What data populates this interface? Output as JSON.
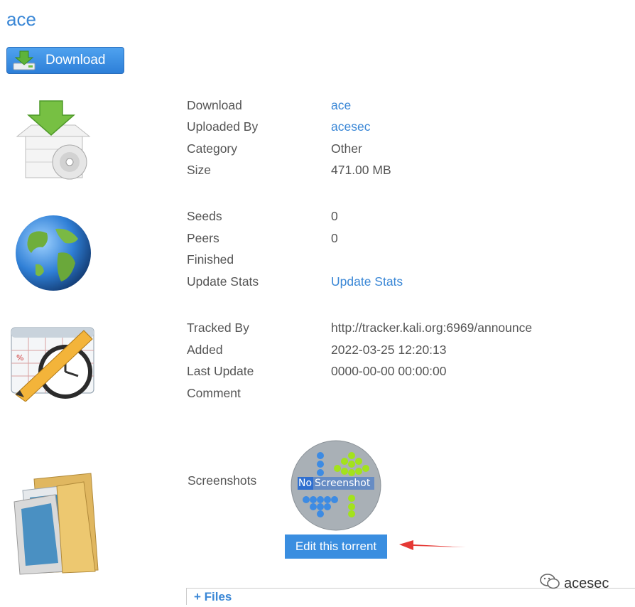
{
  "page": {
    "title": "ace"
  },
  "download_button": {
    "label": "Download",
    "icon": "download-icon"
  },
  "info": {
    "download_label": "Download",
    "download_value": "ace",
    "uploaded_by_label": "Uploaded By",
    "uploaded_by_value": "acesec",
    "category_label": "Category",
    "category_value": "Other",
    "size_label": "Size",
    "size_value": "471.00 MB"
  },
  "stats": {
    "seeds_label": "Seeds",
    "seeds_value": "0",
    "peers_label": "Peers",
    "peers_value": "0",
    "finished_label": "Finished",
    "finished_value": "",
    "update_label": "Update Stats",
    "update_link": "Update Stats"
  },
  "tracking": {
    "tracked_by_label": "Tracked By",
    "tracked_by_value": "http://tracker.kali.org:6969/announce",
    "added_label": "Added",
    "added_value": "2022-03-25 12:20:13",
    "last_update_label": "Last Update",
    "last_update_value": "0000-00-00 00:00:00",
    "comment_label": "Comment",
    "comment_value": ""
  },
  "screenshots": {
    "label": "Screenshots",
    "placeholder_text_no": "No",
    "placeholder_text_shot": "Screenshot",
    "edit_button": "Edit this torrent"
  },
  "files": {
    "toggle_label": "+ Files"
  },
  "watermark": {
    "text": "acesec"
  },
  "colors": {
    "link": "#3a87d6",
    "button": "#3a8ee0",
    "arrow": "#e53935"
  }
}
